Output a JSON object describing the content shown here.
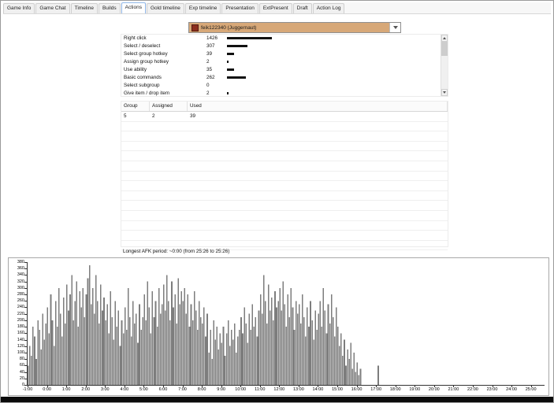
{
  "tabs": [
    "Game Info",
    "Game Chat",
    "Timeline",
    "Builds",
    "Actions",
    "Gold timeline",
    "Exp timeline",
    "Presentation",
    "ExtPresent",
    "Draft",
    "Action Log"
  ],
  "active_tab": "Actions",
  "player_dropdown": {
    "selected": "feik122340 (Juggernaut)",
    "icon": "race-icon"
  },
  "actions_list": {
    "rows": [
      {
        "label": "Right click",
        "count": 1426
      },
      {
        "label": "Select / deselect",
        "count": 307
      },
      {
        "label": "Select group hotkey",
        "count": 39
      },
      {
        "label": "Assign group hotkey",
        "count": 2
      },
      {
        "label": "Use ability",
        "count": 35
      },
      {
        "label": "Basic commands",
        "count": 262
      },
      {
        "label": "Select subgroup",
        "count": 0
      },
      {
        "label": "Give item / drop item",
        "count": 2
      }
    ]
  },
  "group_table": {
    "headers": [
      "Group",
      "Assigned",
      "Used"
    ],
    "rows": [
      [
        "5",
        "2",
        "39"
      ]
    ],
    "empty_row_count": 14
  },
  "afk_text": "Longest AFK period: ~0:00 (from 25:26 to 25:26)",
  "chart_data": {
    "type": "bar",
    "title": "",
    "xlabel": "",
    "ylabel": "",
    "legend": "none",
    "grid": false,
    "ylim": [
      0,
      380
    ],
    "ytick_step": 20,
    "x_start_seconds": -60,
    "bin_seconds": 5,
    "bar_color": "#7d7d7d",
    "xtick_labels": [
      "-1:00",
      "0:00",
      "1:00",
      "2:00",
      "3:00",
      "4:00",
      "5:00",
      "6:00",
      "7:00",
      "8:00",
      "9:00",
      "10:00",
      "11:00",
      "12:00",
      "13:00",
      "14:00",
      "15:00",
      "16:00",
      "17:00",
      "18:00",
      "19:00",
      "20:00",
      "21:00",
      "22:00",
      "23:00",
      "24:00",
      "25:00"
    ],
    "values": [
      60,
      120,
      90,
      180,
      150,
      80,
      200,
      170,
      110,
      220,
      140,
      190,
      240,
      160,
      280,
      200,
      120,
      260,
      180,
      300,
      220,
      150,
      270,
      190,
      310,
      230,
      280,
      340,
      200,
      260,
      320,
      180,
      290,
      240,
      300,
      210,
      280,
      330,
      370,
      250,
      300,
      220,
      340,
      260,
      190,
      310,
      230,
      270,
      200,
      250,
      160,
      290,
      210,
      140,
      260,
      180,
      230,
      120,
      200,
      160,
      240,
      170,
      300,
      210,
      150,
      260,
      190,
      220,
      130,
      250,
      170,
      210,
      280,
      200,
      320,
      240,
      160,
      290,
      210,
      260,
      180,
      300,
      220,
      250,
      310,
      230,
      340,
      260,
      200,
      320,
      240,
      280,
      190,
      330,
      250,
      290,
      260,
      300,
      220,
      280,
      180,
      250,
      200,
      290,
      230,
      170,
      260,
      210,
      190,
      240,
      150,
      220,
      100,
      170,
      80,
      200,
      140,
      180,
      110,
      160,
      130,
      180,
      90,
      160,
      200,
      120,
      170,
      140,
      190,
      100,
      150,
      170,
      210,
      160,
      240,
      190,
      130,
      220,
      170,
      250,
      180,
      210,
      150,
      230,
      280,
      220,
      340,
      260,
      190,
      310,
      230,
      270,
      200,
      290,
      240,
      260,
      300,
      230,
      320,
      250,
      180,
      280,
      210,
      300,
      240,
      170,
      260,
      220,
      250,
      190,
      280,
      210,
      150,
      240,
      180,
      260,
      200,
      140,
      230,
      170,
      220,
      260,
      180,
      300,
      230,
      160,
      250,
      190,
      280,
      210,
      150,
      240,
      180,
      120,
      160,
      90,
      140,
      60,
      110,
      80,
      130,
      50,
      100,
      40,
      70,
      30,
      50,
      0,
      0,
      0,
      0,
      0,
      0,
      0,
      0,
      0,
      0,
      60,
      0,
      0,
      0,
      0,
      0,
      0,
      0,
      0,
      0,
      0,
      0,
      0,
      0,
      0,
      0,
      0,
      0,
      0,
      0,
      0,
      0,
      0,
      0,
      0,
      0,
      0,
      0,
      0,
      0,
      0,
      0,
      0,
      0,
      0,
      0,
      0,
      0,
      0,
      0,
      0,
      0,
      0,
      0,
      0,
      0,
      0,
      0,
      0,
      0,
      0,
      0,
      0,
      0,
      0,
      0,
      0,
      0,
      0,
      0,
      0,
      0,
      0,
      0,
      0,
      0,
      0,
      0,
      0,
      0,
      0,
      0,
      0,
      0,
      0,
      0,
      0,
      0,
      0,
      0,
      0,
      0,
      0,
      0,
      0,
      0,
      0,
      0,
      0,
      0,
      0,
      0,
      0,
      0,
      0,
      0,
      0,
      0,
      0,
      0,
      0,
      0,
      0
    ]
  }
}
